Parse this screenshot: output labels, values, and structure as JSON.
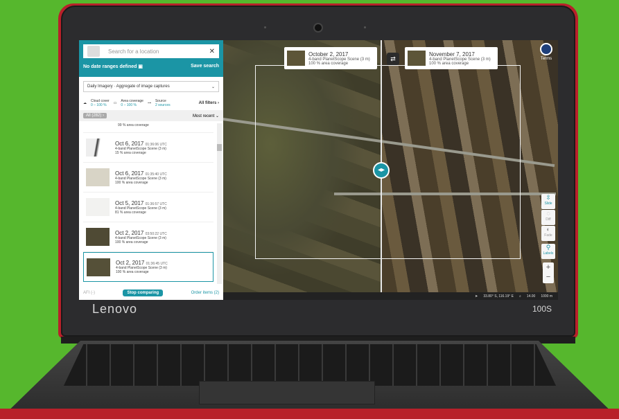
{
  "device": {
    "brand": "Lenovo",
    "model": "100S"
  },
  "search": {
    "placeholder": "Search for a location"
  },
  "date_bar": {
    "label": "No date ranges defined",
    "save": "Save search"
  },
  "imagery_select": "Daily Imagery · Aggregate of image captures",
  "filters": {
    "cloud": {
      "label": "Cloud cover",
      "value": "0 – 100 %"
    },
    "area": {
      "label": "Area coverage",
      "value": "0 – 100 %"
    },
    "source": {
      "label": "Source",
      "value": "2 sources"
    },
    "all": "All filters"
  },
  "list_header": {
    "all": "All (282)",
    "sort": "Most recent"
  },
  "partial_row": "99 % area coverage",
  "results": [
    {
      "date": "Oct 6, 2017",
      "time": "01:36:06 UTC",
      "scene": "4-band PlanetScope Scene (3 m)",
      "coverage": "15 % area coverage"
    },
    {
      "date": "Oct 6, 2017",
      "time": "01:35:40 UTC",
      "scene": "4-band PlanetScope Scene (3 m)",
      "coverage": "100 % area coverage"
    },
    {
      "date": "Oct 5, 2017",
      "time": "01:36:57 UTC",
      "scene": "4-band PlanetScope Scene (3 m)",
      "coverage": "81 % area coverage"
    },
    {
      "date": "Oct 2, 2017",
      "time": "03:50:22 UTC",
      "scene": "4-band PlanetScope Scene (3 m)",
      "coverage": "100 % area coverage"
    },
    {
      "date": "Oct 2, 2017",
      "time": "01:36:45 UTC",
      "scene": "4-band PlanetScope Scene (3 m)",
      "coverage": "100 % area coverage"
    }
  ],
  "footer": {
    "count": "AFI (-)",
    "stop": "Stop comparing",
    "order": "Order items (2)"
  },
  "compare": {
    "left": {
      "date": "October 2, 2017",
      "scene": "4-band PlanetScope Scene (3 m)",
      "coverage": "100 % area coverage"
    },
    "right": {
      "date": "November 7, 2017",
      "scene": "4-band PlanetScope Scene (3 m)",
      "coverage": "100 % area coverage"
    }
  },
  "map_tools": {
    "terms": "Terms",
    "slide": "Slide",
    "diff": "Diff",
    "fade": "Fade",
    "labels": "Labels"
  },
  "status": {
    "coords": "33.80° S, 116.19° E",
    "zoom": "14.00",
    "scale": "1000 m"
  }
}
